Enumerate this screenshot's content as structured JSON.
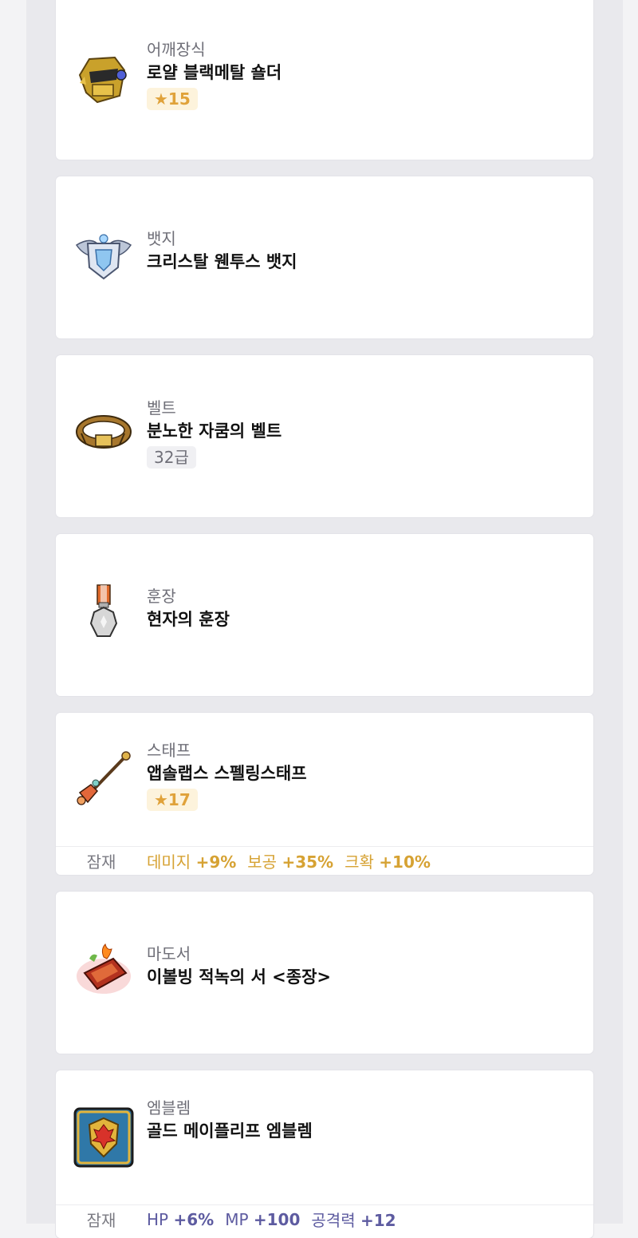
{
  "items": [
    {
      "category": "어깨장식",
      "name": "로얄 블랙메탈 숄더",
      "badge": "★15",
      "icon": "shoulder-icon"
    },
    {
      "category": "뱃지",
      "name": "크리스탈 웬투스 뱃지",
      "icon": "badge-icon"
    },
    {
      "category": "벨트",
      "name": "분노한 자쿰의 벨트",
      "badge": "32급",
      "icon": "belt-icon"
    },
    {
      "category": "훈장",
      "name": "현자의 훈장",
      "icon": "medal-icon"
    },
    {
      "category": "스태프",
      "name": "앱솔랩스 스펠링스태프",
      "badge": "★17",
      "icon": "staff-icon"
    },
    {
      "category": "마도서",
      "name": "이볼빙 적녹의 서 <종장>",
      "icon": "spellbook-icon"
    },
    {
      "category": "엠블렘",
      "name": "골드 메이플리프 엠블렘",
      "icon": "emblem-icon"
    }
  ],
  "potentials": {
    "staff": {
      "label": "잠재",
      "stats": [
        {
          "name": "데미지",
          "value": "+9%"
        },
        {
          "name": "보공",
          "value": "+35%"
        },
        {
          "name": "크확",
          "value": "+10%"
        }
      ]
    },
    "emblem": {
      "label": "잠재",
      "stats": [
        {
          "name": "HP",
          "value": "+6%"
        },
        {
          "name": "MP",
          "value": "+100"
        },
        {
          "name": "공격력",
          "value": "+12"
        }
      ]
    }
  },
  "colors": {
    "potential_gold": "#d6a233",
    "potential_blue": "#5d5ba0",
    "star_badge": "#e0a23a"
  }
}
